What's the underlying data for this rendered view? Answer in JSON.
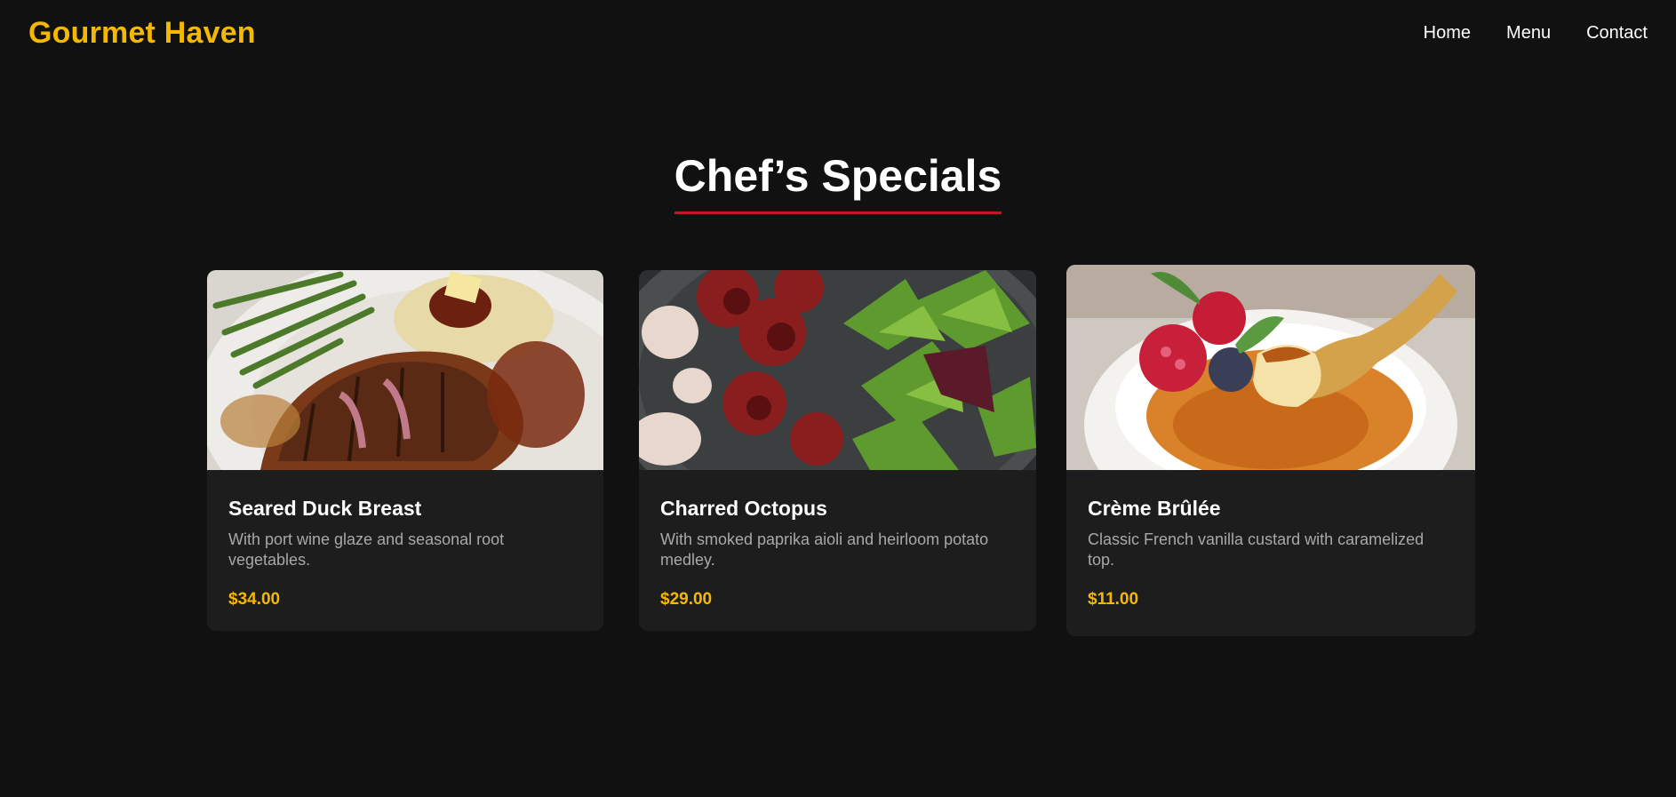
{
  "header": {
    "brand": "Gourmet Haven",
    "nav": [
      "Home",
      "Menu",
      "Contact"
    ]
  },
  "section": {
    "title": "Chef’s Specials"
  },
  "dishes": [
    {
      "name": "Seared Duck Breast",
      "description": "With port wine glaze and seasonal root vegetables.",
      "price": "$34.00",
      "image": "duck-breast-photo"
    },
    {
      "name": "Charred Octopus",
      "description": "With smoked paprika aioli and heirloom potato medley.",
      "price": "$29.00",
      "image": "octopus-salad-photo"
    },
    {
      "name": "Crème Brûlée",
      "description": "Classic French vanilla custard with caramelized top.",
      "price": "$11.00",
      "image": "creme-brulee-photo"
    }
  ],
  "colors": {
    "background": "#111111",
    "card": "#1d1d1d",
    "accent": "#f5b800",
    "underline": "#c0191c"
  }
}
